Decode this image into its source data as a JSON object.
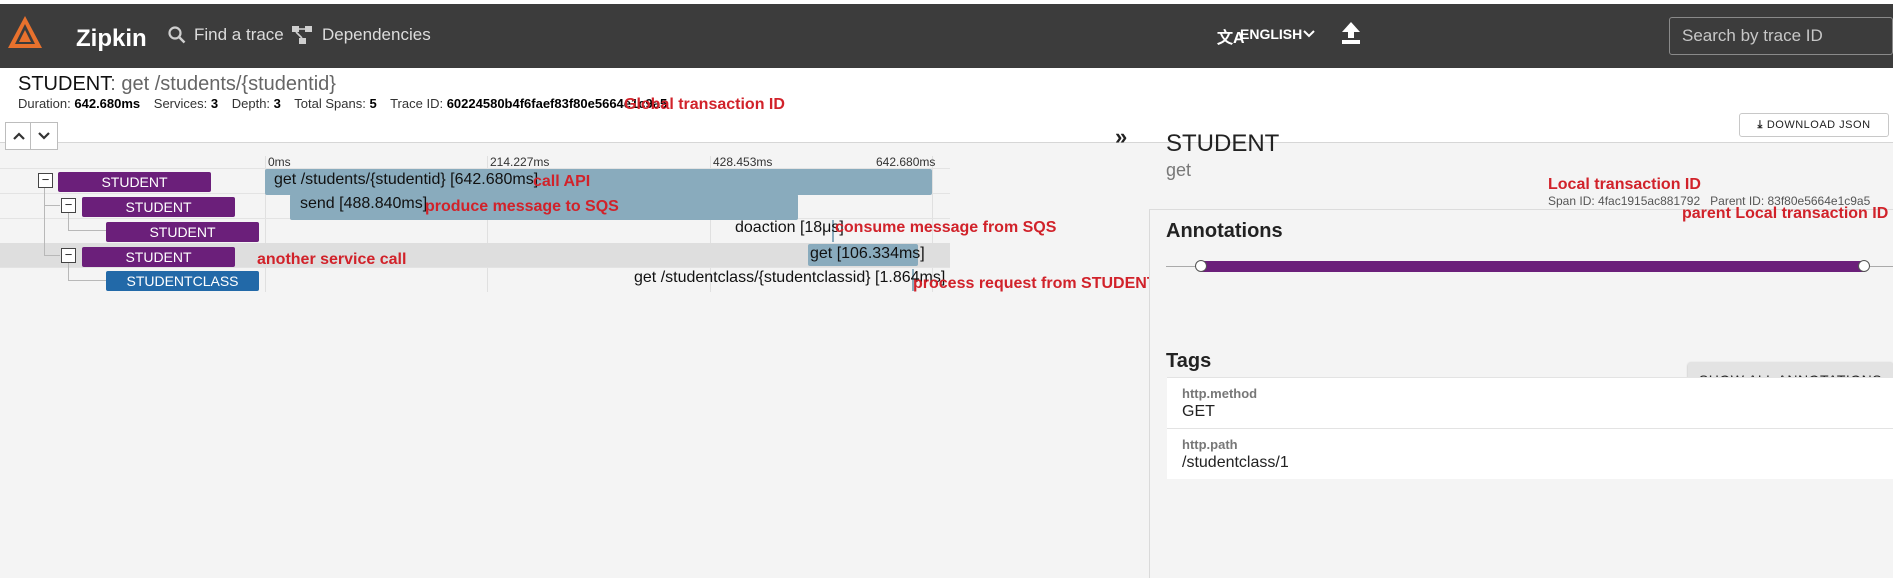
{
  "header": {
    "brand": "Zipkin",
    "nav": {
      "find_trace": "Find a trace",
      "dependencies": "Dependencies"
    },
    "language": "ENGLISH",
    "search_placeholder": "Search by trace ID"
  },
  "trace": {
    "service": "STUDENT",
    "name": ": get /students/{studentid}",
    "meta": {
      "duration_label": "Duration:",
      "duration": "642.680ms",
      "services_label": "Services:",
      "services": "3",
      "depth_label": "Depth:",
      "depth": "3",
      "spans_label": "Total Spans:",
      "spans": "5",
      "traceid_label": "Trace ID:",
      "traceid": "60224580b4f6faef83f80e5664e1c9a5"
    },
    "download_label": "DOWNLOAD JSON"
  },
  "timeline": {
    "ticks": [
      "0ms",
      "214.227ms",
      "428.453ms",
      "642.680ms"
    ],
    "rows": [
      {
        "service": "STUDENT",
        "label": "get /students/{studentid} [642.680ms]",
        "color": "#6b1f7a"
      },
      {
        "service": "STUDENT",
        "label": "send [488.840ms]",
        "color": "#6b1f7a"
      },
      {
        "service": "STUDENT",
        "label": "doaction [18μs]",
        "color": "#6b1f7a"
      },
      {
        "service": "STUDENT",
        "label": "get [106.334ms]",
        "color": "#6b1f7a"
      },
      {
        "service": "STUDENTCLASS",
        "label": "get /studentclass/{studentclassid} [1.864ms]",
        "color": "#2269a8"
      }
    ]
  },
  "detail": {
    "service": "STUDENT",
    "span_name": "get",
    "span_id": "Span ID: 4fac1915ac881792",
    "parent_id": "Parent ID: 83f80e5664e1c9a5",
    "annotations_title": "Annotations",
    "show_all_label": "SHOW ALL ANNOTATIONS",
    "tags_title": "Tags",
    "tags": [
      {
        "key": "http.method",
        "value": "GET"
      },
      {
        "key": "http.path",
        "value": "/studentclass/1"
      }
    ]
  },
  "overlay_annotations": {
    "global_id": "Global transaction ID",
    "call_api": "call API",
    "produce": "produce message to SQS",
    "consume": "consume message from SQS",
    "another": "another service call",
    "process": "process request from STUDENT service",
    "local_id": "Local transaction ID",
    "parent_local_id": "parent Local transaction ID"
  },
  "colors": {
    "header_bg": "#3c3c3c",
    "service_purple": "#6b1f7a",
    "service_blue": "#2269a8",
    "span_bar": "#89abbd",
    "annotation_red": "#d1222a",
    "logo_orange": "#e8712d"
  }
}
